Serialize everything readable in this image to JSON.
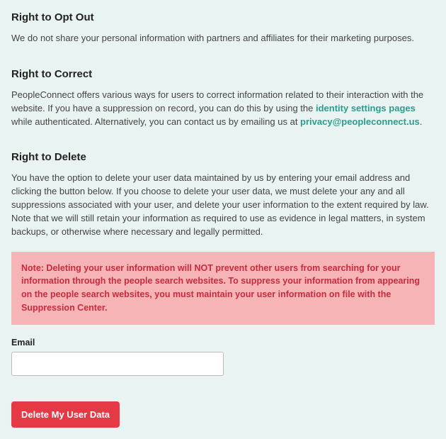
{
  "optout": {
    "heading": "Right to Opt Out",
    "body": "We do not share your personal information with partners and affiliates for their marketing purposes."
  },
  "correct": {
    "heading": "Right to Correct",
    "body_pre": "PeopleConnect offers various ways for users to correct information related to their interaction with the website. If you have a suppression on record, you can do this by using the ",
    "link1_text": "identity settings pages",
    "body_mid": " while authenticated. Alternatively, you can contact us by emailing us at ",
    "link2_text": "privacy@peopleconnect.us",
    "body_post": "."
  },
  "delete": {
    "heading": "Right to Delete",
    "body": "You have the option to delete your user data maintained by us by entering your email address and clicking the button below. If you choose to delete your user data, we must delete your any and all suppressions associated with your user, and delete your user information to the extent required by law. Note that we will still retain your information as required to use as evidence in legal matters, in system backups, or otherwise where necessary and legally permitted.",
    "note": "Note: Deleting your user information will NOT prevent other users from searching for your information through the people search websites. To suppress your information from appearing on the people search websites, you must maintain your user information on file with the Suppression Center.",
    "email_label": "Email",
    "button_label": "Delete My User Data"
  }
}
